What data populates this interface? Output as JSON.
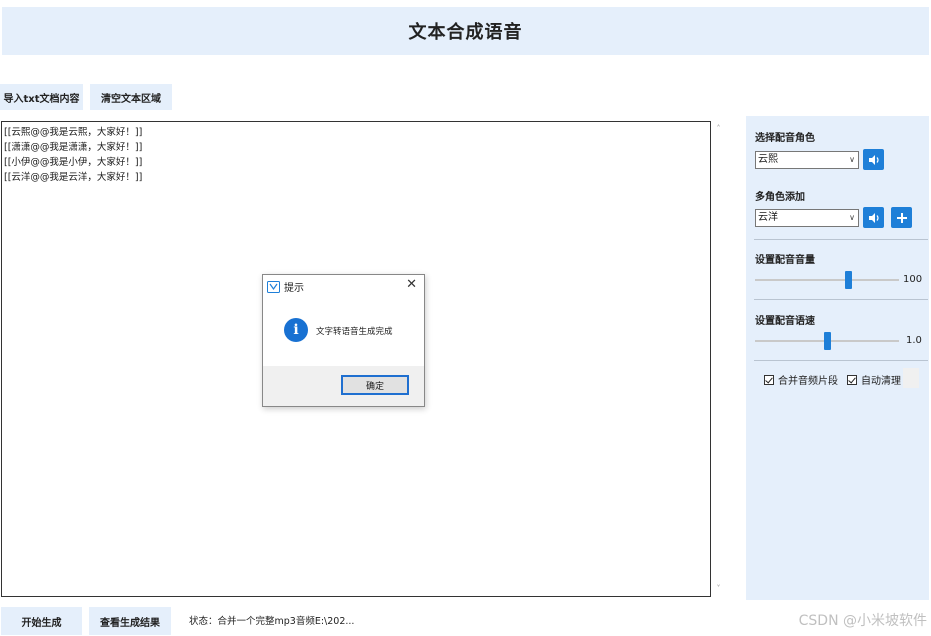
{
  "window": {
    "title": "文本合成语音"
  },
  "toolbar": {
    "import_label": "导入txt文档内容",
    "clear_label": "清空文本区域"
  },
  "editor": {
    "lines": [
      "[[云熙@@我是云熙，大家好！]]",
      "[[潇潇@@我是潇潇，大家好！]]",
      "[[小伊@@我是小伊，大家好！]]",
      "[[云洋@@我是云洋，大家好！]]"
    ]
  },
  "sidebar": {
    "voice_label": "选择配音角色",
    "voice_value": "云熙",
    "multi_label": "多角色添加",
    "multi_value": "云洋",
    "volume_label": "设置配音音量",
    "volume_value": "100",
    "volume_fraction": 0.65,
    "speed_label": "设置配音语速",
    "speed_value": "1.0",
    "speed_fraction": 0.5,
    "merge_label": "合并音频片段",
    "merge_checked": true,
    "autoclean_label": "自动清理",
    "autoclean_checked": true
  },
  "bottom": {
    "start_label": "开始生成",
    "view_label": "查看生成结果",
    "status_text": "状态：合并一个完整mp3音频E:\\202..."
  },
  "dialog": {
    "title": "提示",
    "message": "文字转语音生成完成",
    "ok_label": "确定"
  },
  "watermark": "CSDN @小米坡软件",
  "colors": {
    "accent": "#1e7fd8",
    "panel_bg": "#e5effb"
  },
  "icons": {
    "speaker": "speaker-icon",
    "add": "plus-icon",
    "info": "info-icon",
    "close": "close-icon",
    "app": "app-icon"
  }
}
